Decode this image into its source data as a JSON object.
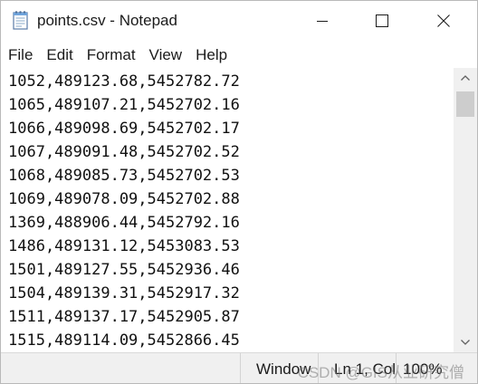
{
  "window": {
    "title": "points.csv - Notepad",
    "controls": {
      "minimize": "minimize",
      "maximize": "maximize",
      "close": "close"
    }
  },
  "menu": [
    "File",
    "Edit",
    "Format",
    "View",
    "Help"
  ],
  "lines": [
    "1052,489123.68,5452782.72",
    "1065,489107.21,5452702.16",
    "1066,489098.69,5452702.17",
    "1067,489091.48,5452702.52",
    "1068,489085.73,5452702.53",
    "1069,489078.09,5452702.88",
    "1369,488906.44,5452792.16",
    "1486,489131.12,5453083.53",
    "1501,489127.55,5452936.46",
    "1504,489139.31,5452917.32",
    "1511,489137.17,5452905.87",
    "1515,489114.09,5452866.45"
  ],
  "status": {
    "line_ending": "Window",
    "position": "Ln 1, Col",
    "zoom": "100%"
  },
  "watermark": "CSDN @GIS从业研究僧",
  "colors": {
    "scrollbar_track": "#f0f0f0",
    "scrollbar_thumb": "#cdcdcd",
    "statusbar": "#f0f0f0"
  }
}
